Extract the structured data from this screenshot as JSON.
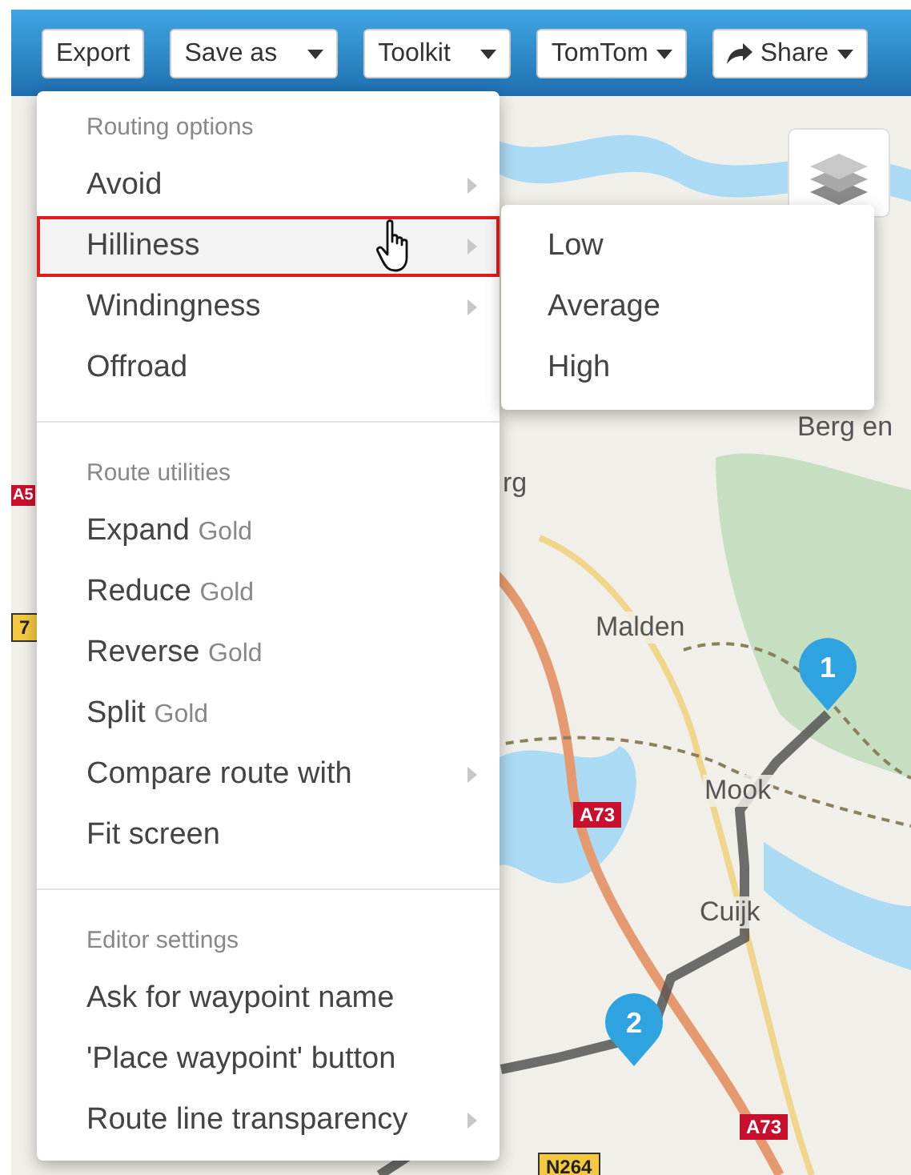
{
  "toolbar": {
    "buttons": [
      {
        "label": "Export",
        "kind": "plain"
      },
      {
        "label": "Save as",
        "kind": "dropdown"
      },
      {
        "label": "Toolkit",
        "kind": "dropdown"
      },
      {
        "label": "TomTom",
        "kind": "dropdown"
      },
      {
        "label": "Share",
        "kind": "share"
      }
    ]
  },
  "menu": {
    "sections": [
      {
        "heading": "Routing options",
        "items": [
          {
            "label": "Avoid",
            "has_submenu": true,
            "selected": false
          },
          {
            "label": "Hilliness",
            "has_submenu": true,
            "selected": true
          },
          {
            "label": "Windingness",
            "has_submenu": true,
            "selected": false
          },
          {
            "label": "Offroad",
            "has_submenu": false,
            "selected": false
          }
        ]
      },
      {
        "heading": "Route utilities",
        "items": [
          {
            "label": "Expand",
            "badge": "Gold",
            "has_submenu": false,
            "selected": false
          },
          {
            "label": "Reduce",
            "badge": "Gold",
            "has_submenu": false,
            "selected": false
          },
          {
            "label": "Reverse",
            "badge": "Gold",
            "has_submenu": false,
            "selected": false
          },
          {
            "label": "Split",
            "badge": "Gold",
            "has_submenu": false,
            "selected": false
          },
          {
            "label": "Compare route with",
            "has_submenu": true,
            "selected": false
          },
          {
            "label": "Fit screen",
            "has_submenu": false,
            "selected": false
          }
        ]
      },
      {
        "heading": "Editor settings",
        "items": [
          {
            "label": "Ask for waypoint name",
            "has_submenu": false,
            "selected": false
          },
          {
            "label": "'Place waypoint' button",
            "has_submenu": false,
            "selected": false
          },
          {
            "label": "Route line transparency",
            "has_submenu": true,
            "selected": false
          }
        ]
      }
    ]
  },
  "submenu": {
    "items": [
      "Low",
      "Average",
      "High"
    ]
  },
  "map": {
    "labels": [
      {
        "text": "Berg en",
        "kind": "place"
      },
      {
        "text": "rg",
        "kind": "place"
      },
      {
        "text": "Malden",
        "kind": "place"
      },
      {
        "text": "Mook",
        "kind": "place"
      },
      {
        "text": "Cuijk",
        "kind": "place"
      },
      {
        "text": "A73",
        "kind": "motorway"
      },
      {
        "text": "A73",
        "kind": "motorway"
      },
      {
        "text": "N264",
        "kind": "road"
      },
      {
        "text": "A5",
        "kind": "motorway"
      },
      {
        "text": "7",
        "kind": "road"
      }
    ],
    "waypoints": [
      "1",
      "2"
    ]
  }
}
